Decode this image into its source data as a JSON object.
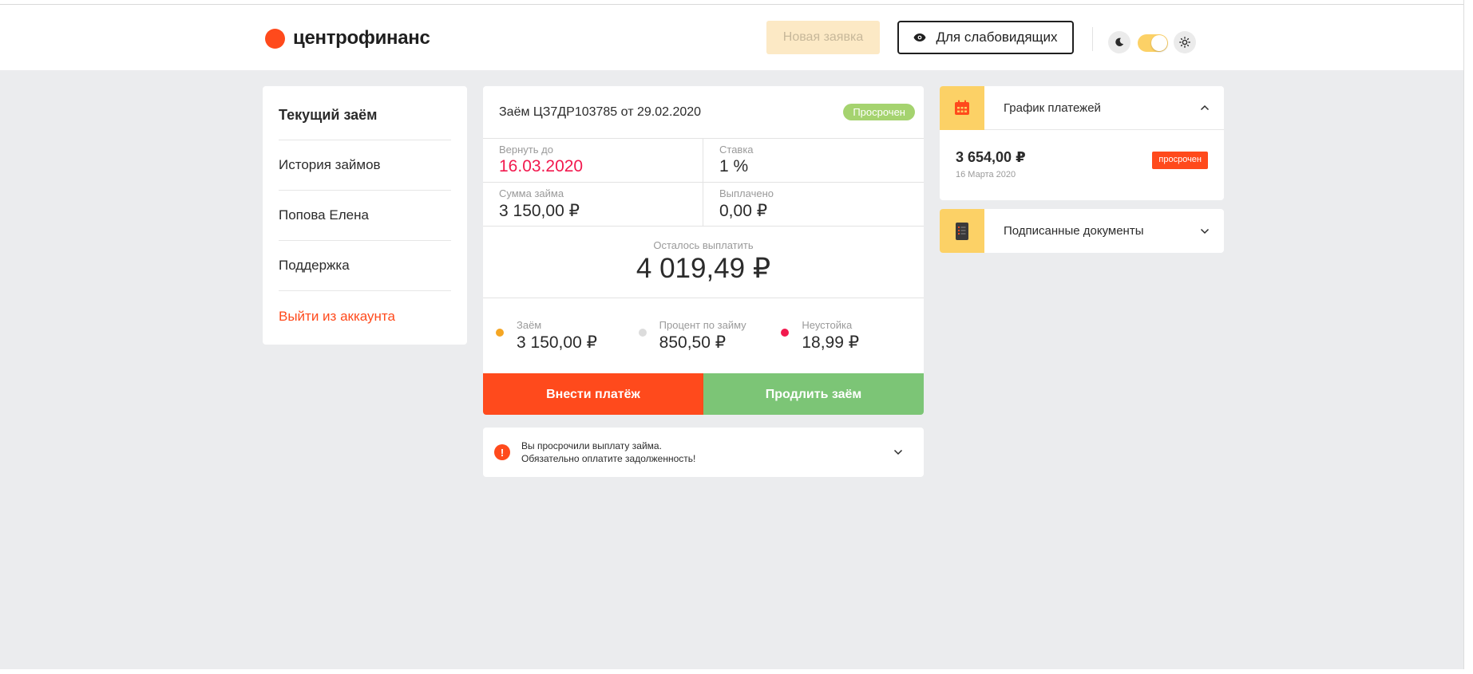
{
  "header": {
    "logo_text": "центрофинанс",
    "new_application_label": "Новая заявка",
    "vision_mode_label": "Для слабовидящих"
  },
  "sidebar": {
    "items": [
      {
        "label": "Текущий заём"
      },
      {
        "label": "История займов"
      },
      {
        "label": "Попова Елена"
      },
      {
        "label": "Поддержка"
      },
      {
        "label": "Выйти из аккаунта"
      }
    ]
  },
  "loan": {
    "title": "Заём ЦЗ7ДР103785 от 29.02.2020",
    "status": "Просрочен",
    "return_by_label": "Вернуть до",
    "return_by_value": "16.03.2020",
    "rate_label": "Ставка",
    "rate_value": "1 %",
    "amount_label": "Сумма займа",
    "amount_value": "3 150,00 ₽",
    "paid_label": "Выплачено",
    "paid_value": "0,00 ₽",
    "remaining_label": "Осталось выплатить",
    "remaining_value": "4 019,49 ₽",
    "breakdown": [
      {
        "label": "Заём",
        "value": "3 150,00 ₽",
        "color": "#f5a623"
      },
      {
        "label": "Процент по займу",
        "value": "850,50 ₽",
        "color": "#dcdcdc"
      },
      {
        "label": "Неустойка",
        "value": "18,99 ₽",
        "color": "#f2194e"
      }
    ],
    "pay_button_label": "Внести платёж",
    "extend_button_label": "Продлить заём"
  },
  "warning": {
    "line1": "Вы просрочили выплату займа.",
    "line2": "Обязательно оплатите задолженность!",
    "icon_glyph": "!"
  },
  "schedule": {
    "title": "График платежей",
    "amount": "3 654,00 ₽",
    "date": "16 Марта 2020",
    "status": "просрочен"
  },
  "documents": {
    "title": "Подписанные документы"
  },
  "colors": {
    "brand": "#ff4a1c",
    "accent_yellow": "#fcd166",
    "success_green": "#7cc576",
    "danger_red": "#f2194e"
  }
}
